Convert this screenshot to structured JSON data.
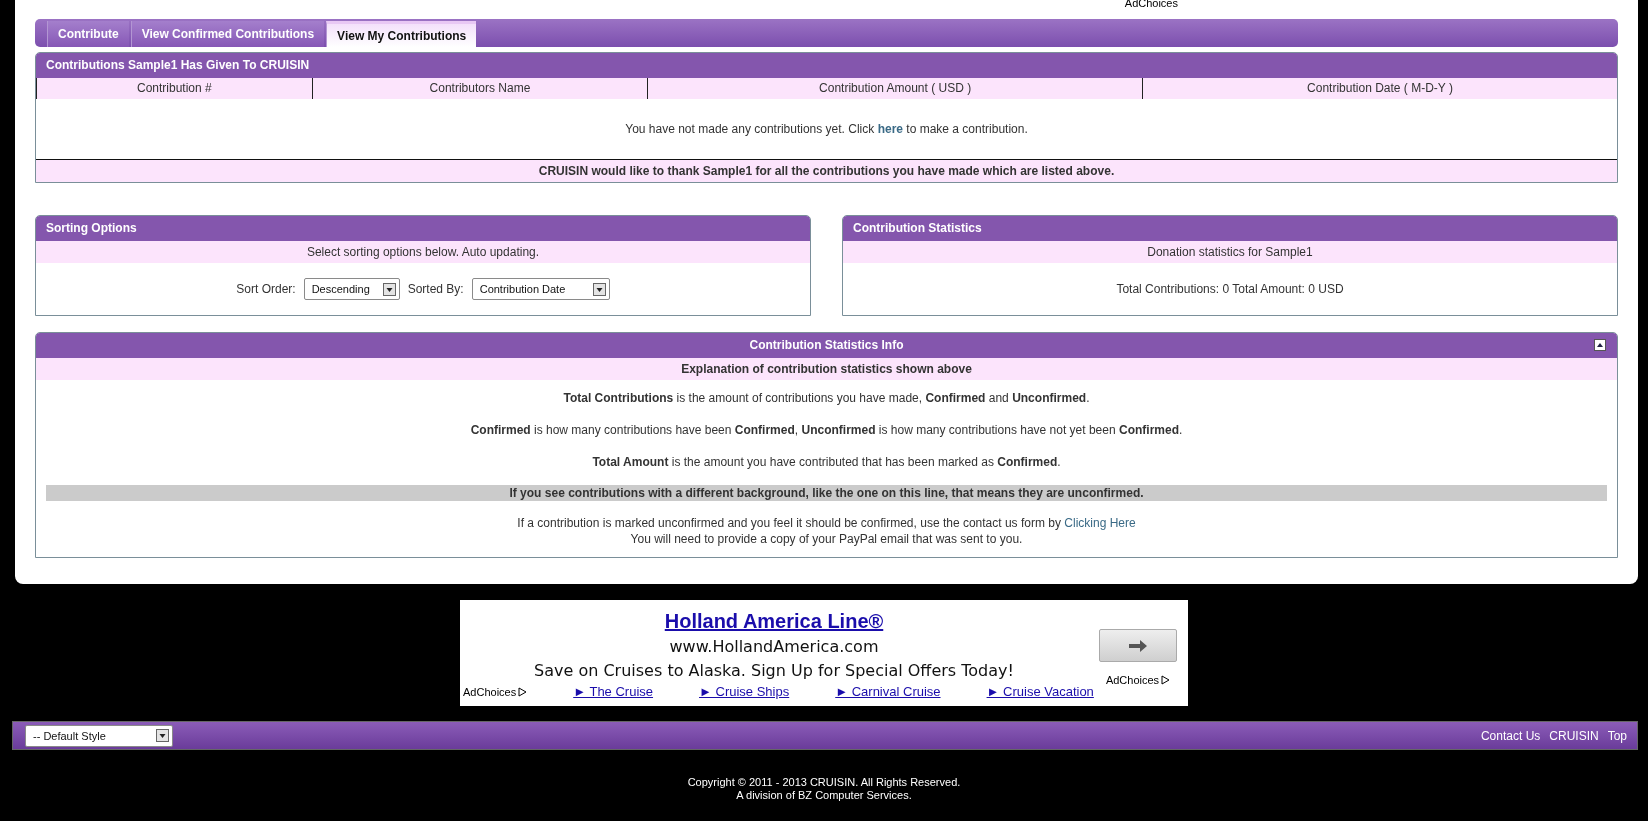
{
  "top_ad": {
    "adchoices": "AdChoices"
  },
  "tabs": [
    {
      "label": "Contribute",
      "selected": false
    },
    {
      "label": "View Confirmed Contributions",
      "selected": false
    },
    {
      "label": "View My Contributions",
      "selected": true
    }
  ],
  "contributions": {
    "title": "Contributions Sample1 Has Given To CRUISIN",
    "columns": [
      "Contribution #",
      "Contributors Name",
      "Contribution Amount ( USD )",
      "Contribution Date ( M-D-Y )"
    ],
    "empty_before": "You have not made any contributions yet. Click",
    "empty_link": "here",
    "empty_after": "to make a contribution.",
    "thanks": "CRUISIN would like to thank Sample1 for all the contributions you have made which are listed above."
  },
  "sorting": {
    "title": "Sorting Options",
    "subtitle": "Select sorting options below. Auto updating.",
    "fields": [
      {
        "label": "Sort Order:",
        "value": "Descending"
      },
      {
        "label": "Sorted By:",
        "value": "Contribution Date"
      }
    ]
  },
  "statistics": {
    "title": "Contribution Statistics",
    "subtitle": "Donation statistics for Sample1",
    "summary": "Total Contributions: 0 Total Amount: 0 USD"
  },
  "info": {
    "title": "Contribution Statistics Info",
    "expanded": true,
    "subtitle": "Explanation of contribution statistics shown above",
    "paragraphs": [
      "**Total Contributions** is the amount of contributions you have made, **Confirmed** and **Unconfirmed**.",
      "**Confirmed** is how many contributions have been **Confirmed**, **Unconfirmed** is how many contributions have not yet been **Confirmed**.",
      "**Total Amount** is the amount you have contributed that has been marked as **Confirmed**."
    ],
    "unconfirmed_example": "If you see contributions with a different background, like the one on this line, that means they are unconfirmed.",
    "help_before": "If a contribution is marked unconfirmed and you feel it should be confirmed, use the contact us form by",
    "help_link": "Clicking Here",
    "help_note": "You will need to provide a copy of your PayPal email that was sent to you."
  },
  "ad": {
    "headline": "Holland America Line®",
    "url": "www.HollandAmerica.com",
    "text": "Save on Cruises to Alaska. Sign Up for Special Offers Today!",
    "adchoices_right": "AdChoices",
    "adchoices_left": "AdChoices",
    "links": [
      "► The Cruise",
      "► Cruise Ships",
      "► Carnival Cruise",
      "► Cruise Vacation"
    ]
  },
  "footer": {
    "style_select": "-- Default Style",
    "links": [
      "Contact Us",
      "CRUISIN",
      "Top"
    ],
    "copyright": "Copyright © 2011 - 2013 CRUISIN. All Rights Reserved.",
    "division": "A division of BZ Computer Services."
  }
}
